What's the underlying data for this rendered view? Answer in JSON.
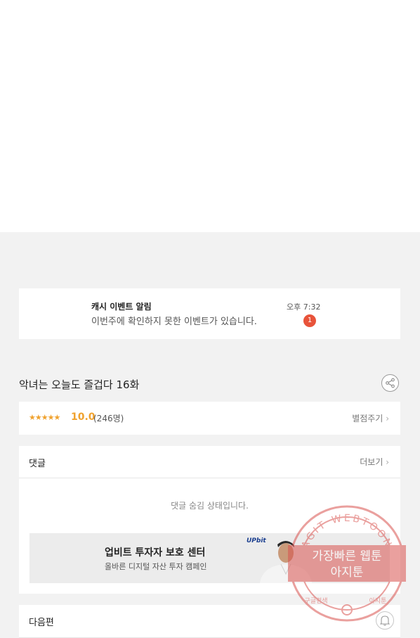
{
  "event": {
    "title": "캐시 이벤트 알림",
    "message": "이번주에 확인하지 못한 이벤트가 있습니다.",
    "time": "오후 7:32",
    "badge_count": "1"
  },
  "episode": {
    "title": "악녀는 오늘도 즐겁다 16화"
  },
  "rating": {
    "stars": "★★★★★",
    "score": "10.0",
    "count": "(246명)",
    "rate_label": "별점주기",
    "chevron": "›"
  },
  "comments": {
    "title": "댓글",
    "more_label": "더보기",
    "chevron": "›",
    "hidden_message": "댓글 숨김 상태입니다."
  },
  "ad": {
    "title": "업비트 투자자 보호 센터",
    "subtitle": "올바른 디지털 자산 투자 캠페인",
    "brand": "UPbit"
  },
  "next": {
    "title": "다음편"
  },
  "watermark": {
    "ring_text": "AGIT WEBTOON",
    "line1": "가장빠른 웹툰",
    "line2": "아지툰",
    "bottom_left": "구글검색",
    "bottom_right": "아지툰"
  },
  "colors": {
    "accent": "#f0a22e",
    "badge": "#e8533a",
    "watermark": "#d9534f"
  }
}
